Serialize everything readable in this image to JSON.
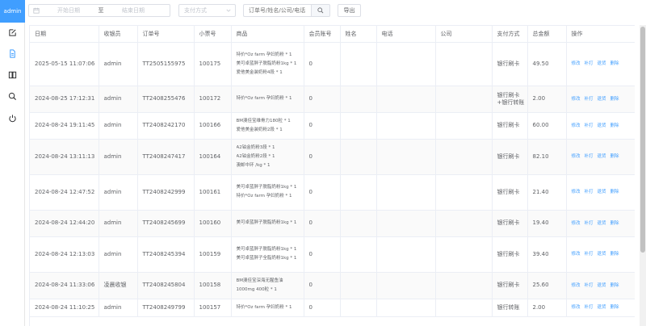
{
  "sidebar": {
    "user": "admin",
    "items": [
      {
        "icon": "edit-icon"
      },
      {
        "icon": "document-icon"
      },
      {
        "icon": "book-icon"
      },
      {
        "icon": "search-icon"
      },
      {
        "icon": "power-icon"
      }
    ]
  },
  "toolbar": {
    "start_placeholder": "开始日期",
    "range_separator": "至",
    "end_placeholder": "结束日期",
    "payment_placeholder": "支付方式",
    "search_placeholder": "订单号/姓名/公司/电话",
    "export_label": "导出"
  },
  "table": {
    "columns": [
      "日期",
      "收银员",
      "订单号",
      "小票号",
      "商品",
      "会员账号",
      "姓名",
      "电话",
      "公司",
      "支付方式",
      "总金额",
      "操作"
    ],
    "actions": [
      "修改",
      "补打",
      "退货",
      "删除"
    ],
    "rows": [
      {
        "date": "2025-05-15 11:07:06",
        "cashier": "admin",
        "order": "TT2505155975",
        "receipt": "100175",
        "goods": [
          "特价*Oz farm 孕妇奶粉 * 1",
          "美可卓蓝胖子脱脂奶粉1kg * 1",
          "爱他美金装奶粉4段 * 1"
        ],
        "member": "0",
        "name": "",
        "phone": "",
        "company": "",
        "payment": [
          "银行刷卡"
        ],
        "total": "49.50"
      },
      {
        "date": "2024-08-25 17:12:31",
        "cashier": "admin",
        "order": "TT2408255476",
        "receipt": "100172",
        "goods": [
          "特价*Oz farm 孕妇奶粉 * 1"
        ],
        "member": "0",
        "name": "",
        "phone": "",
        "company": "",
        "payment": [
          "银行刷卡",
          "+银行转账"
        ],
        "total": "2.00"
      },
      {
        "date": "2024-08-24 19:11:45",
        "cashier": "admin",
        "order": "TT2408242170",
        "receipt": "100166",
        "goods": [
          "BM澳佳宝维骨力180粒 * 1",
          "爱他美金装奶粉2段 * 1"
        ],
        "member": "0",
        "name": "",
        "phone": "",
        "company": "",
        "payment": [
          "银行刷卡"
        ],
        "total": "60.00"
      },
      {
        "date": "2024-08-24 13:11:13",
        "cashier": "admin",
        "order": "TT2408247417",
        "receipt": "100164",
        "goods": [
          "A2铂金奶粉3段 * 1",
          "A2铂金奶粉2段 * 1",
          "澳邮中环 /kg * 1"
        ],
        "member": "0",
        "name": "",
        "phone": "",
        "company": "",
        "payment": [
          "银行刷卡"
        ],
        "total": "82.10"
      },
      {
        "date": "2024-08-24 12:47:52",
        "cashier": "admin",
        "order": "TT2408242999",
        "receipt": "100161",
        "goods": [
          "美可卓蓝胖子脱脂奶粉1kg * 1",
          "特价*Oz farm 孕妇奶粉 * 1"
        ],
        "member": "0",
        "name": "",
        "phone": "",
        "company": "",
        "payment": [
          "银行刷卡"
        ],
        "total": "21.40"
      },
      {
        "date": "2024-08-24 12:44:20",
        "cashier": "admin",
        "order": "TT2408245699",
        "receipt": "100160",
        "goods": [
          "美可卓蓝胖子脱脂奶粉1kg * 1"
        ],
        "member": "0",
        "name": "",
        "phone": "",
        "company": "",
        "payment": [
          "银行刷卡"
        ],
        "total": "19.40"
      },
      {
        "date": "2024-08-24 12:13:03",
        "cashier": "admin",
        "order": "TT2408245394",
        "receipt": "100159",
        "goods": [
          "美可卓蓝胖子脱脂奶粉1kg * 1",
          "美可卓蓝胖子全脂奶粉1kg * 1"
        ],
        "member": "0",
        "name": "",
        "phone": "",
        "company": "",
        "payment": [
          "银行刷卡"
        ],
        "total": "39.40"
      },
      {
        "date": "2024-08-24 11:33:06",
        "cashier": "凌晨收银",
        "order": "TT2408245804",
        "receipt": "100158",
        "goods": [
          "BM澳佳宝深海无腥鱼油",
          "1000mg 400粒 * 1"
        ],
        "member": "0",
        "name": "",
        "phone": "",
        "company": "",
        "payment": [
          "银行刷卡"
        ],
        "total": "25.60"
      },
      {
        "date": "2024-08-24 11:10:25",
        "cashier": "admin",
        "order": "TT2408249799",
        "receipt": "100157",
        "goods": [
          "特价*Oz farm 孕妇奶粉 * 1"
        ],
        "member": "0",
        "name": "",
        "phone": "",
        "company": "",
        "payment": [
          "银行转账"
        ],
        "total": "2.00"
      }
    ]
  }
}
